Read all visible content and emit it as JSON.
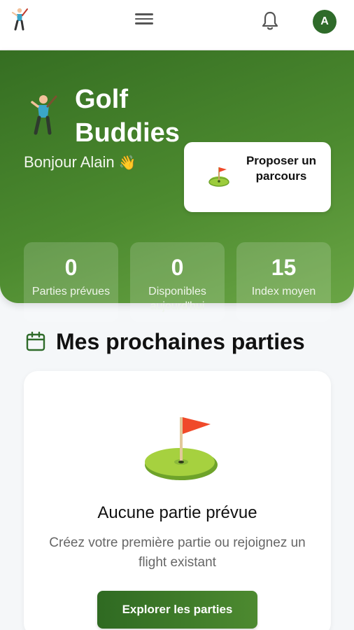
{
  "header": {
    "logo_icon": "golfer-icon",
    "menu_icon": "hamburger-icon",
    "notifications_icon": "bell-icon",
    "avatar_initial": "A"
  },
  "hero": {
    "app_name": "Golf Buddies",
    "greeting": "Bonjour Alain",
    "greeting_emoji": "👋",
    "propose_button_label": "Proposer un parcours",
    "stats": [
      {
        "value": "0",
        "label": "Parties prévues"
      },
      {
        "value": "0",
        "label": "Disponibles aujourd'hui"
      },
      {
        "value": "15",
        "label": "Index moyen"
      }
    ]
  },
  "upcoming": {
    "title": "Mes prochaines parties",
    "empty_title": "Aucune partie prévue",
    "empty_subtitle": "Créez votre première partie ou rejoignez un flight existant",
    "explore_button_label": "Explorer les parties"
  },
  "colors": {
    "brand_green": "#356e22",
    "brand_green_light": "#6aa545",
    "flag_red": "#f04a2a",
    "text_muted": "#666666"
  }
}
